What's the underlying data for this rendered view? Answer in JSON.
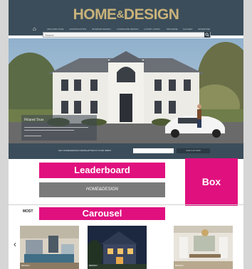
{
  "header": {
    "logo_home": "HOME",
    "logo_amp": "&",
    "logo_design": "DESIGN",
    "nav_items": [
      "ARCHITECTURE",
      "CONSTRUCTION",
      "INTERIOR DESIGN",
      "LANDSCAPE DESIGN",
      "LUXURY LIVING",
      "MAGAZINE",
      "GALLERY",
      "ADVERTISE"
    ]
  },
  "search": {
    "placeholder": "Search"
  },
  "hero": {
    "caption_title": "Pillared Trust"
  },
  "signup": {
    "prompt": "GET HOME&DESIGN NEWSLETTER IN YOUR INBOX",
    "button": "SIGN UP NOW"
  },
  "ads": {
    "leaderboard": "Leaderboard",
    "box": "Box",
    "carousel": "Carousel"
  },
  "banner": {
    "text": "HOME&DESIGN"
  },
  "carousel": {
    "section_label": "MOST",
    "prev": "‹",
    "next": "›",
    "slides": [
      {
        "caption": "DESIGN"
      },
      {
        "caption": "DESIGN"
      },
      {
        "caption": "DESIGN"
      }
    ]
  },
  "colors": {
    "header": "#3b4d5a",
    "logo": "#c9b27a",
    "ad_magenta": "#e0107f",
    "banner_gray": "#7a7a7a"
  }
}
